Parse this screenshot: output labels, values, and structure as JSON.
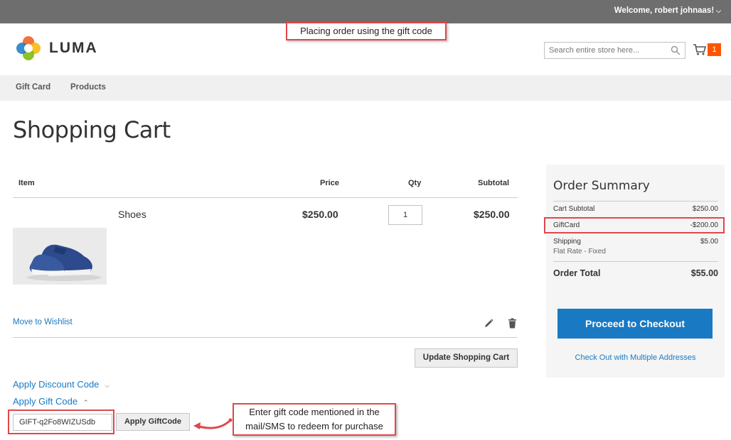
{
  "header": {
    "welcome": "Welcome, robert johnaas!",
    "logo_text": "LUMA",
    "search_placeholder": "Search entire store here...",
    "cart_count": "1"
  },
  "annotations": {
    "top": "Placing order using the gift code",
    "bottom": "Enter gift code mentioned in the mail/SMS to redeem for purchase"
  },
  "nav": {
    "items": [
      "Gift Card",
      "Products"
    ]
  },
  "page": {
    "title": "Shopping Cart"
  },
  "cart": {
    "columns": [
      "Item",
      "Price",
      "Qty",
      "Subtotal"
    ],
    "items": [
      {
        "name": "Shoes",
        "price": "$250.00",
        "qty": "1",
        "subtotal": "$250.00"
      }
    ],
    "move_to_wishlist": "Move to Wishlist",
    "update_button": "Update Shopping Cart",
    "apply_discount": "Apply Discount Code",
    "apply_gift": "Apply Gift Code",
    "gift_code_value": "GIFT-q2Fo8WIZUSdb",
    "apply_gift_button": "Apply GiftCode"
  },
  "summary": {
    "title": "Order Summary",
    "cart_subtotal_label": "Cart Subtotal",
    "cart_subtotal_value": "$250.00",
    "giftcard_label": "GiftCard",
    "giftcard_value": "-$200.00",
    "shipping_label": "Shipping",
    "shipping_value": "$5.00",
    "shipping_method": "Flat Rate - Fixed",
    "order_total_label": "Order Total",
    "order_total_value": "$55.00",
    "checkout_button": "Proceed to Checkout",
    "multi_address": "Check Out with Multiple Addresses"
  },
  "colors": {
    "accent": "#1979c3",
    "cart_badge": "#ff5501",
    "annotation_border": "#e0474c",
    "topbar": "#6e6e6e"
  }
}
